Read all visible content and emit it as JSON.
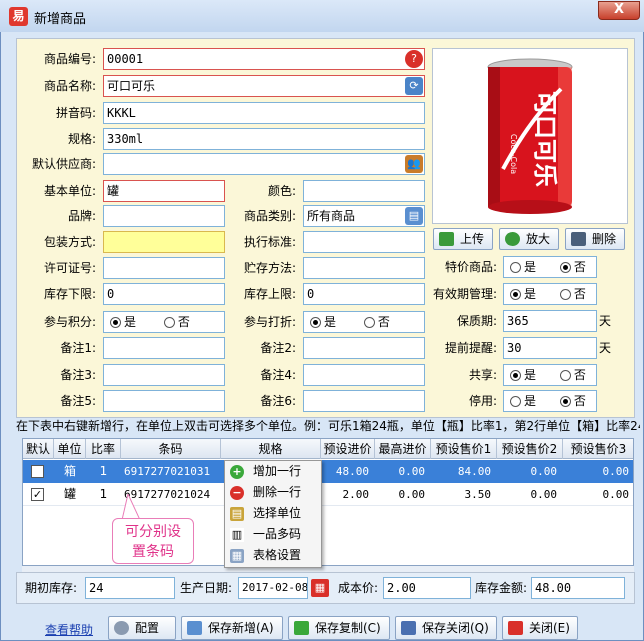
{
  "window": {
    "title": "新增商品",
    "icon": "易",
    "close_label": "X"
  },
  "form": {
    "code_label": "商品编号:",
    "code_value": "00001",
    "name_label": "商品名称:",
    "name_value": "可口可乐",
    "pinyin_label": "拼音码:",
    "pinyin_value": "KKKL",
    "spec_label": "规格:",
    "spec_value": "330ml",
    "supplier_label": "默认供应商:",
    "supplier_value": "",
    "unit_label": "基本单位:",
    "unit_value": "罐",
    "color_label": "颜色:",
    "color_value": "",
    "brand_label": "品牌:",
    "brand_value": "",
    "category_label": "商品类别:",
    "category_value": "所有商品",
    "pack_label": "包装方式:",
    "pack_value": "",
    "standard_label": "执行标准:",
    "standard_value": "",
    "license_label": "许可证号:",
    "license_value": "",
    "storage_label": "贮存方法:",
    "storage_value": "",
    "stock_min_label": "库存下限:",
    "stock_min_value": "0",
    "stock_max_label": "库存上限:",
    "stock_max_value": "0",
    "points_label": "参与积分:",
    "points_yes": "是",
    "points_no": "否",
    "discount_label": "参与打折:",
    "discount_yes": "是",
    "discount_no": "否",
    "note1_label": "备注1:",
    "note2_label": "备注2:",
    "note3_label": "备注3:",
    "note4_label": "备注4:",
    "note5_label": "备注5:",
    "note6_label": "备注6:",
    "special_label": "特价商品:",
    "special_yes": "是",
    "special_no": "否",
    "expiry_mgmt_label": "有效期管理:",
    "expiry_yes": "是",
    "expiry_no": "否",
    "shelf_life_label": "保质期:",
    "shelf_life_value": "365",
    "shelf_life_unit": "天",
    "remind_label": "提前提醒:",
    "remind_value": "30",
    "remind_unit": "天",
    "share_label": "共享:",
    "share_yes": "是",
    "share_no": "否",
    "disable_label": "停用:",
    "disable_yes": "是",
    "disable_no": "否"
  },
  "photo": {
    "upload": "上传",
    "zoom": "放大",
    "delete": "删除",
    "can_brand": "Coca-Cola",
    "can_text": "可口可乐"
  },
  "hint": "在下表中右键新增行，在单位上双击可选择多个单位。例：可乐1箱24瓶，单位【瓶】比率1，第2行单位【箱】比率24",
  "grid": {
    "headers": [
      "默认",
      "单位",
      "比率",
      "条码",
      "规格",
      "预设进价",
      "最高进价",
      "预设售价1",
      "预设售价2",
      "预设售价3"
    ],
    "rows": [
      {
        "default": false,
        "unit": "箱",
        "ratio": "1",
        "barcode": "6917277021031",
        "spec": "",
        "cost": "48.00",
        "max_cost": "0.00",
        "price1": "84.00",
        "price2": "0.00",
        "price3": "0.00"
      },
      {
        "default": true,
        "unit": "罐",
        "ratio": "1",
        "barcode": "6917277021024",
        "spec": "",
        "cost": "2.00",
        "max_cost": "0.00",
        "price1": "3.50",
        "price2": "0.00",
        "price3": "0.00"
      }
    ]
  },
  "context_menu": [
    "增加一行",
    "删除一行",
    "选择单位",
    "一品多码",
    "表格设置"
  ],
  "callout": {
    "line1": "可分别设",
    "line2": "置条码"
  },
  "bottom": {
    "init_stock_label": "期初库存:",
    "init_stock_value": "24",
    "prod_date_label": "生产日期:",
    "prod_date_value": "2017-02-08",
    "cost_label": "成本价:",
    "cost_value": "2.00",
    "amount_label": "库存金额:",
    "amount_value": "48.00"
  },
  "buttons": {
    "help": "查看帮助",
    "config": "配置",
    "save_new": "保存新增(A)",
    "save_copy": "保存复制(C)",
    "save_close": "保存关闭(Q)",
    "close": "关闭(E)"
  },
  "colors": {
    "accent": "#7fb2d9",
    "selected_row": "#3a80d8",
    "required_border": "#d9534f"
  }
}
